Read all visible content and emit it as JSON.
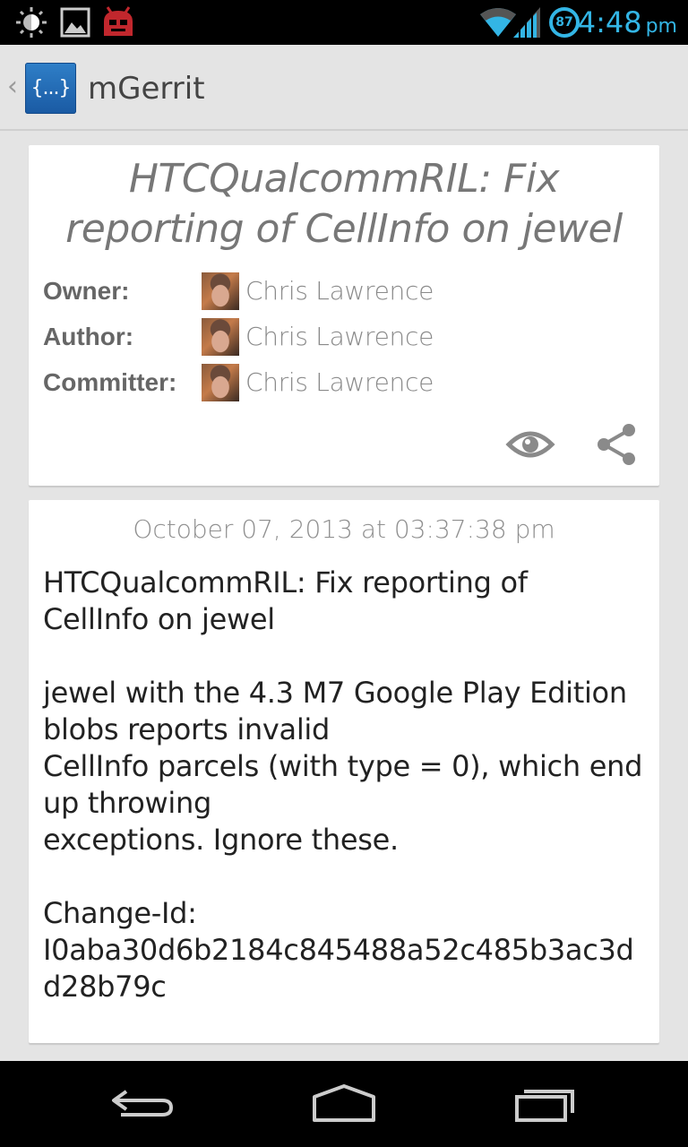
{
  "status_bar": {
    "time": "4:48",
    "ampm": "pm",
    "battery_level": "87",
    "accent_color": "#33b5e5",
    "icons": [
      "brightness-icon",
      "image-icon",
      "cyanogenmod-android-icon",
      "wifi-icon",
      "cell-signal-icon",
      "battery-icon"
    ]
  },
  "action_bar": {
    "title": "mGerrit",
    "logo_text": "{...}"
  },
  "change": {
    "subject": "HTCQualcommRIL: Fix reporting of CellInfo on jewel",
    "people": [
      {
        "label": "Owner:",
        "name": "Chris Lawrence"
      },
      {
        "label": "Author:",
        "name": "Chris Lawrence"
      },
      {
        "label": "Committer:",
        "name": "Chris Lawrence"
      }
    ],
    "actions": [
      "watch-icon",
      "share-icon"
    ]
  },
  "commit": {
    "date": "October 07, 2013 at 03:37:38 pm",
    "message": "HTCQualcommRIL: Fix reporting of\nCellInfo on jewel\n\njewel with the 4.3 M7 Google Play Edition\nblobs reports invalid\nCellInfo parcels (with type = 0), which end\nup throwing\nexceptions. Ignore these.\n\nChange-Id:\nI0aba30d6b2184c845488a52c485b3ac3d\nd28b79c"
  },
  "nav_bar": {
    "buttons": [
      "back-icon",
      "home-icon",
      "recents-icon"
    ]
  }
}
